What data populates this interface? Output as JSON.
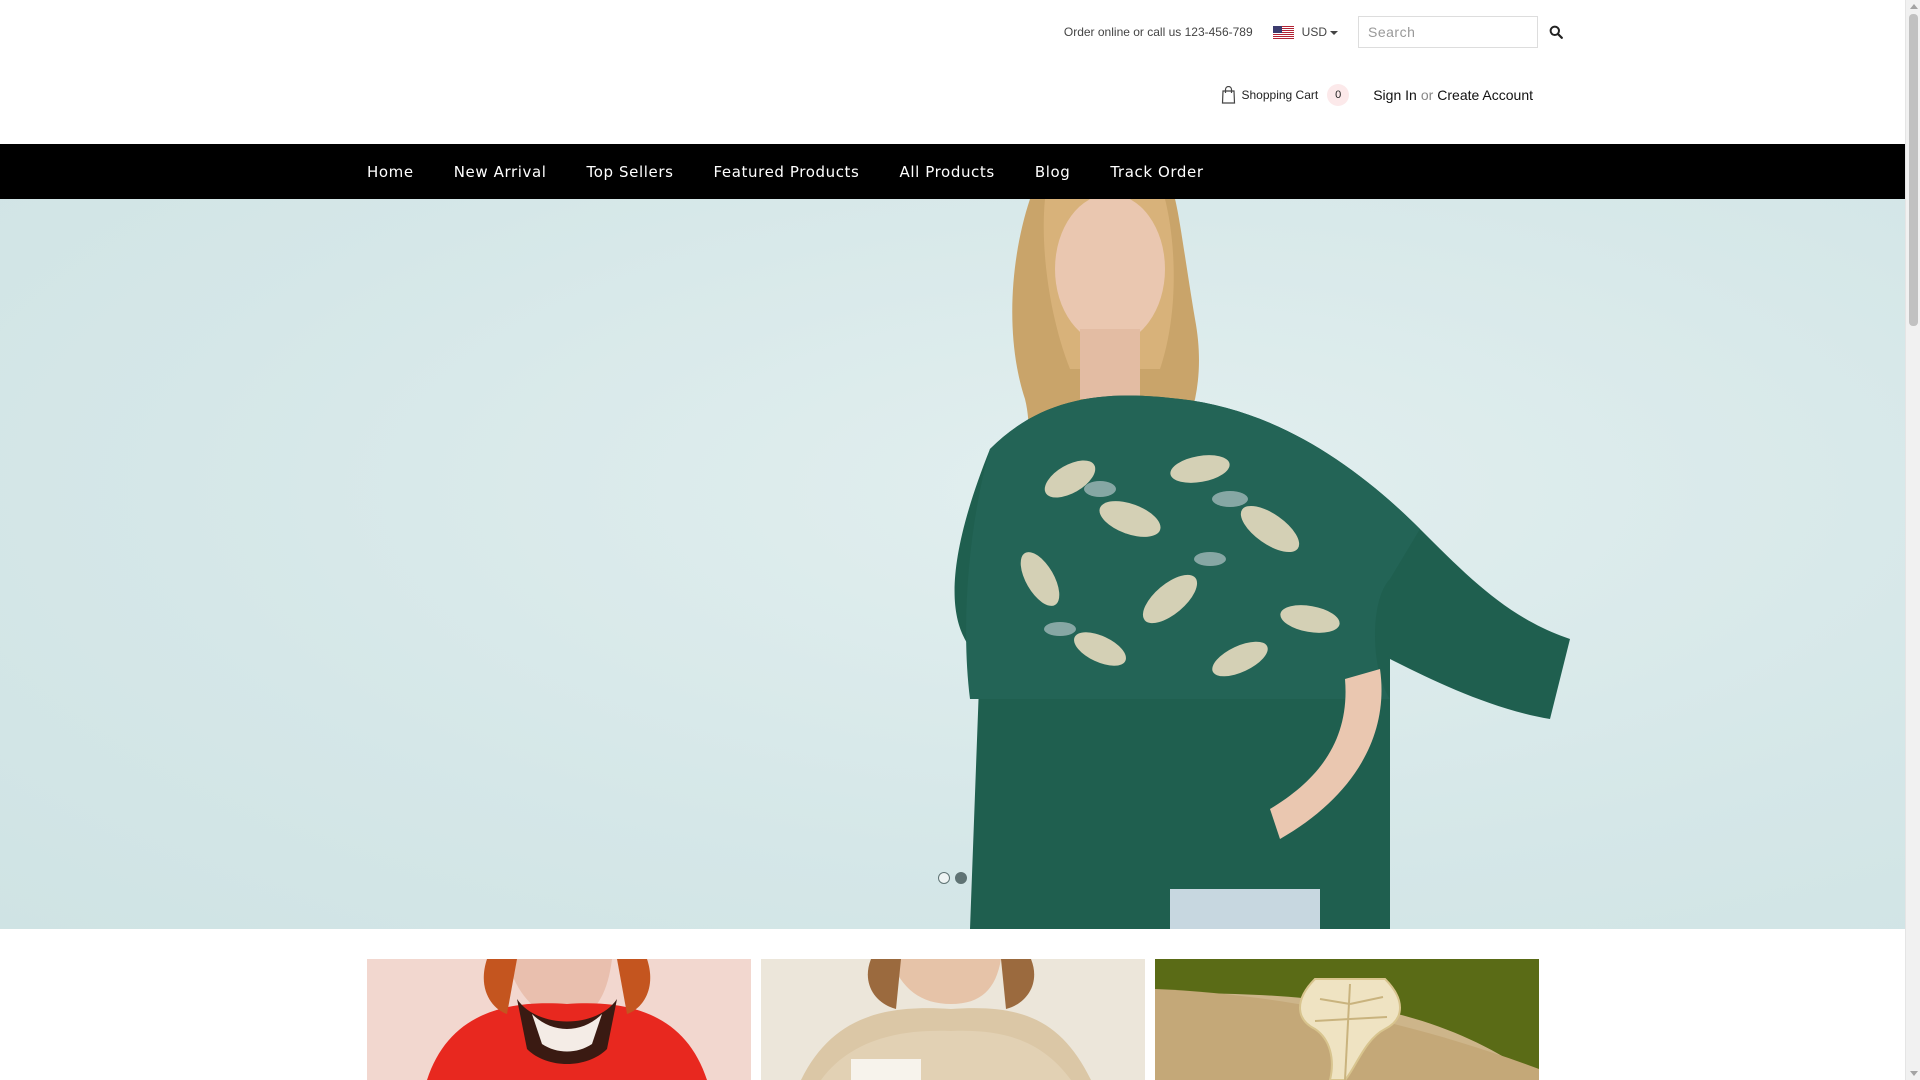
{
  "topbar": {
    "contact_text": "Order online or call us 123-456-789",
    "currency": "USD",
    "flag_icon": "us-flag-icon",
    "search_placeholder": "Search",
    "search_value": ""
  },
  "account": {
    "cart_label": "Shopping Cart",
    "cart_count": "0",
    "sign_in": "Sign In",
    "or": "or",
    "create_account": "Create Account"
  },
  "nav": {
    "items": [
      {
        "label": "Home"
      },
      {
        "label": "New Arrival"
      },
      {
        "label": "Top Sellers"
      },
      {
        "label": "Featured Products"
      },
      {
        "label": "All Products"
      },
      {
        "label": "Blog"
      },
      {
        "label": "Track Order"
      }
    ]
  },
  "hero": {
    "background_color": "#dcebeb",
    "top_color": "#1f5f4f",
    "slides_total": 2,
    "active_slide": 2
  },
  "tiles": [
    {
      "name": "red-top-tile",
      "color": "#e8281f"
    },
    {
      "name": "knit-top-tile",
      "color": "#e9dccb"
    },
    {
      "name": "leaf-earring-tile",
      "color": "#7a8a1f"
    }
  ],
  "colors": {
    "nav_bg": "#000000",
    "cart_badge_bg": "#fce9ea"
  }
}
